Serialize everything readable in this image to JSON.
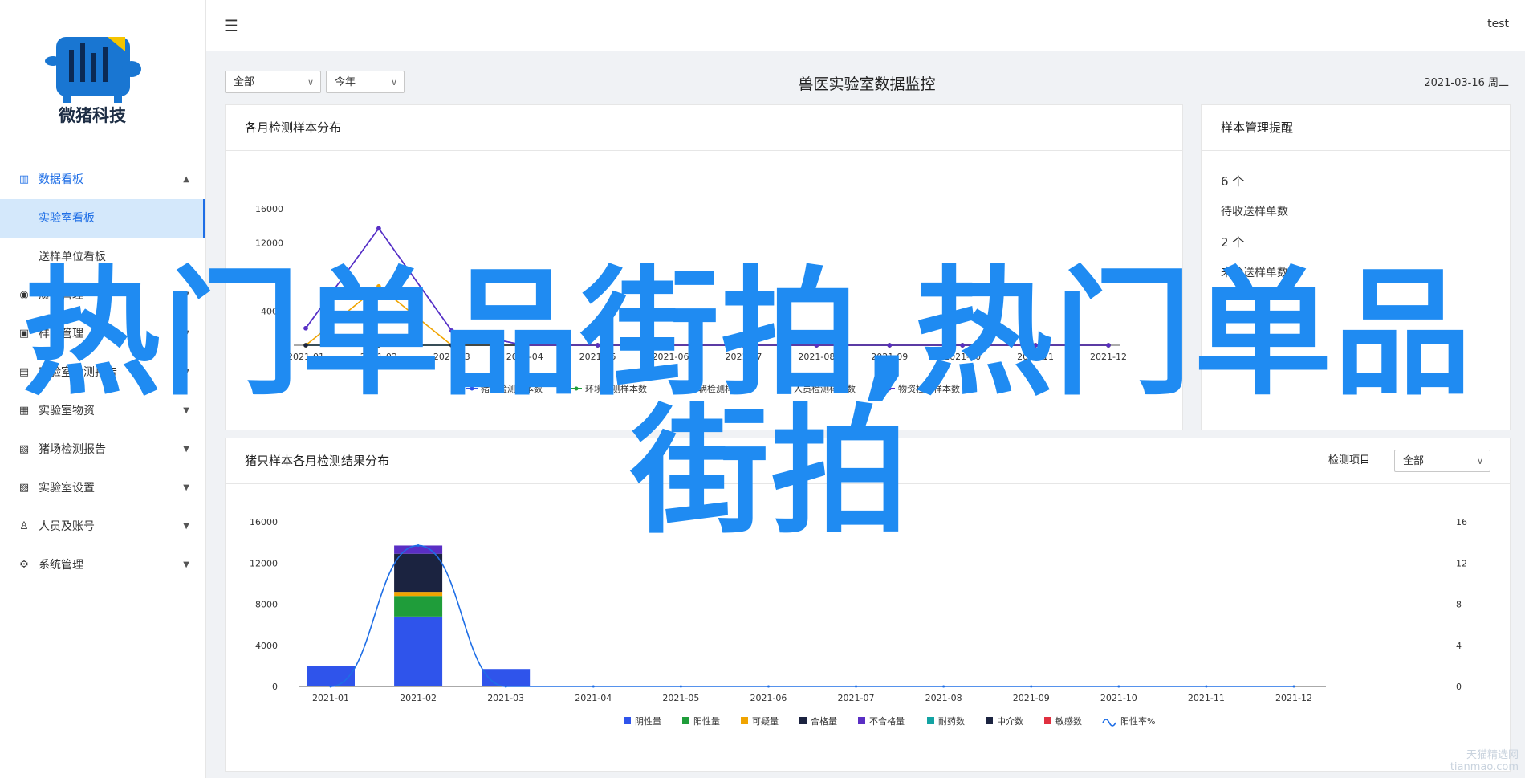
{
  "app": {
    "brand": "微猪科技",
    "user": "test"
  },
  "menu": [
    {
      "icon": "bar-chart-icon",
      "label": "数据看板",
      "open": true
    },
    {
      "label": "实验室看板",
      "active": true
    },
    {
      "label": "送样单位看板"
    },
    {
      "icon": "eye-icon",
      "label": "质控管理"
    },
    {
      "icon": "lock-icon",
      "label": "样品管理"
    },
    {
      "icon": "document-icon",
      "label": "实验室检测报告"
    },
    {
      "icon": "clipboard-icon",
      "label": "实验室物资"
    },
    {
      "icon": "report-icon",
      "label": "猪场检测报告"
    },
    {
      "icon": "file-settings-icon",
      "label": "实验室设置"
    },
    {
      "icon": "user-icon",
      "label": "人员及账号"
    },
    {
      "icon": "gear-icon",
      "label": "系统管理"
    }
  ],
  "filters": {
    "scope": "全部",
    "period": "今年"
  },
  "page": {
    "title": "兽医实验室数据监控",
    "date": "2021-03-16 周二"
  },
  "card1": {
    "title": "各月检测样本分布"
  },
  "reminders": {
    "title": "样本管理提醒",
    "items": [
      {
        "value": "6 个",
        "label": "待收送样单数"
      },
      {
        "value": "2 个",
        "label": "未检送样单数"
      }
    ]
  },
  "card2": {
    "title": "猪只样本各月检测结果分布",
    "filter_label": "检测项目",
    "filter_value": "全部"
  },
  "overlay": {
    "line1": "热门单品街拍,热门单品",
    "line2": "街拍"
  },
  "watermark": {
    "line1": "天猫精选网",
    "line2": "tianmao.com"
  },
  "colors": {
    "accent": "#1e6ee6",
    "overlay": "#1f8bf2"
  },
  "chart_data": [
    {
      "type": "line",
      "title": "各月检测样本分布",
      "categories": [
        "2021-01",
        "2021-02",
        "2021-03",
        "2021-04",
        "2021-05",
        "2021-06",
        "2021-07",
        "2021-08",
        "2021-09",
        "2021-10",
        "2021-11",
        "2021-12"
      ],
      "ylim": [
        0,
        16000
      ],
      "yticks": [
        0,
        4000,
        8000,
        12000,
        16000
      ],
      "grid": false,
      "legend_position": "bottom",
      "series": [
        {
          "name": "猪只检测样本数",
          "color": "#2f54eb",
          "values": [
            2000,
            13700,
            1700,
            0,
            0,
            0,
            0,
            0,
            0,
            0,
            0,
            0
          ]
        },
        {
          "name": "环境检测样本数",
          "color": "#1f9d3a",
          "values": [
            0,
            0,
            0,
            0,
            0,
            0,
            0,
            0,
            0,
            0,
            0,
            0
          ]
        },
        {
          "name": "车辆检测样本量",
          "color": "#f0a400",
          "values": [
            0,
            6900,
            0,
            0,
            0,
            0,
            0,
            0,
            0,
            0,
            0,
            0
          ]
        },
        {
          "name": "人员检测样本数",
          "color": "#1b2340",
          "values": [
            0,
            0,
            0,
            0,
            0,
            0,
            0,
            0,
            0,
            0,
            0,
            0
          ]
        },
        {
          "name": "物资检测样本数",
          "color": "#5a2ec4",
          "values": [
            2000,
            13700,
            1700,
            0,
            0,
            0,
            0,
            0,
            0,
            0,
            0,
            0
          ]
        }
      ]
    },
    {
      "type": "bar",
      "stacked": true,
      "title": "猪只样本各月检测结果分布",
      "categories": [
        "2021-01",
        "2021-02",
        "2021-03",
        "2021-04",
        "2021-05",
        "2021-06",
        "2021-07",
        "2021-08",
        "2021-09",
        "2021-10",
        "2021-11",
        "2021-12"
      ],
      "ylim": [
        0,
        16000
      ],
      "yticks": [
        0,
        4000,
        8000,
        12000,
        16000
      ],
      "y2lim": [
        0,
        16
      ],
      "y2ticks": [
        0,
        4,
        8,
        12,
        16
      ],
      "grid": false,
      "legend_position": "bottom",
      "series": [
        {
          "name": "阴性量",
          "color": "#2f54eb",
          "values": [
            2000,
            6800,
            1700,
            0,
            0,
            0,
            0,
            0,
            0,
            0,
            0,
            0
          ]
        },
        {
          "name": "阳性量",
          "color": "#1f9d3a",
          "values": [
            0,
            2000,
            0,
            0,
            0,
            0,
            0,
            0,
            0,
            0,
            0,
            0
          ]
        },
        {
          "name": "可疑量",
          "color": "#f0a400",
          "values": [
            0,
            400,
            0,
            0,
            0,
            0,
            0,
            0,
            0,
            0,
            0,
            0
          ]
        },
        {
          "name": "合格量",
          "color": "#1b2340",
          "values": [
            0,
            3700,
            0,
            0,
            0,
            0,
            0,
            0,
            0,
            0,
            0,
            0
          ]
        },
        {
          "name": "不合格量",
          "color": "#5a2ec4",
          "values": [
            0,
            800,
            0,
            0,
            0,
            0,
            0,
            0,
            0,
            0,
            0,
            0
          ]
        },
        {
          "name": "耐药数",
          "color": "#13a3a3",
          "values": [
            0,
            0,
            0,
            0,
            0,
            0,
            0,
            0,
            0,
            0,
            0,
            0
          ]
        },
        {
          "name": "中介数",
          "color": "#1b2340",
          "values": [
            0,
            0,
            0,
            0,
            0,
            0,
            0,
            0,
            0,
            0,
            0,
            0
          ]
        },
        {
          "name": "敏感数",
          "color": "#e03040",
          "values": [
            0,
            0,
            0,
            0,
            0,
            0,
            0,
            0,
            0,
            0,
            0,
            0
          ]
        }
      ],
      "line_series": {
        "name": "阳性率%",
        "color": "#1e6ee6",
        "axis": "right",
        "values": [
          0,
          13.7,
          0,
          0,
          0,
          0,
          0,
          0,
          0,
          0,
          0,
          0
        ]
      }
    }
  ]
}
